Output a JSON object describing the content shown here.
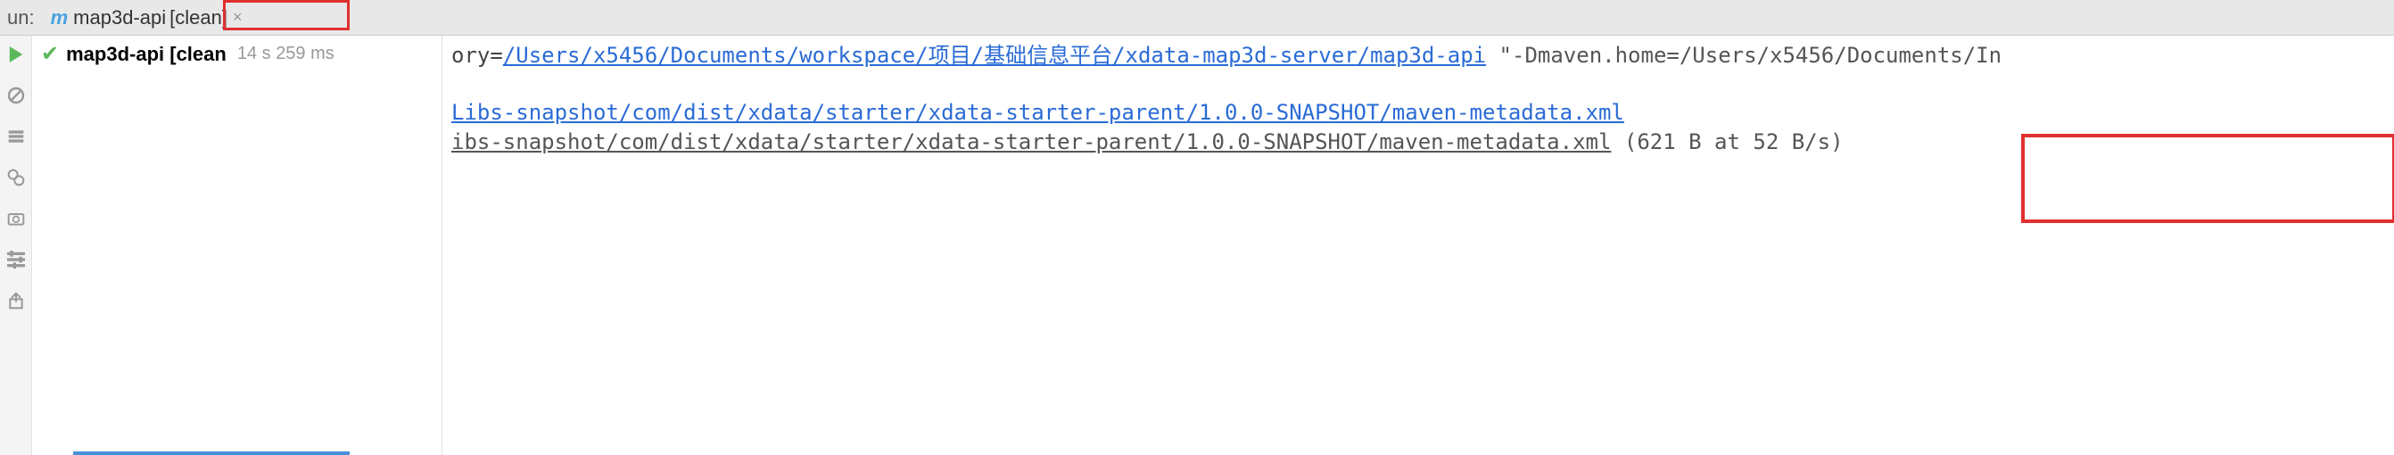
{
  "tab_bar": {
    "run_label": "un:",
    "tab": {
      "icon": "m",
      "label_prefix": "map3d-api",
      "label_suffix": "[clean]",
      "close": "×"
    }
  },
  "tree": {
    "label": "map3d-api [clean",
    "duration": "14 s 259 ms"
  },
  "console": {
    "line1_prefix": "ory=",
    "line1_link": "/Users/x5456/Documents/workspace/项目/基础信息平台/xdata-map3d-server/map3d-api",
    "line1_suffix": " \"-Dmaven.home=/Users/x5456/Documents/In",
    "line2_link": "Libs-snapshot/com/dist/xdata/starter/xdata-starter-parent/1.0.0-SNAPSHOT/maven-metadata.xml",
    "line3_text": "ibs-snapshot/com/dist/xdata/starter/xdata-starter-parent/1.0.0-SNAPSHOT/maven-metadata.xml",
    "line3_suffix": " (621 B at 52 B/s)"
  },
  "gutter_icons": [
    "play",
    "stop",
    "history",
    "layers",
    "screenshot",
    "settings",
    "export"
  ]
}
